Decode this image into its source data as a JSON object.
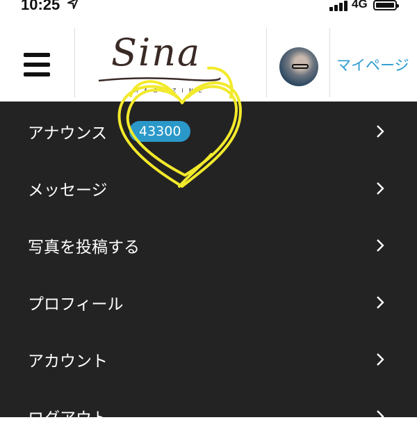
{
  "status_bar": {
    "time": "10:25",
    "network": "4G"
  },
  "header": {
    "logo_text": "Sina",
    "logo_sub": "MAGAZINE",
    "mypage_label": "マイページ"
  },
  "menu": {
    "items": [
      {
        "label": "アナウンス",
        "badge": "43300"
      },
      {
        "label": "メッセージ"
      },
      {
        "label": "写真を投稿する"
      },
      {
        "label": "プロフィール"
      },
      {
        "label": "アカウント"
      },
      {
        "label": "ログアウト"
      }
    ]
  },
  "colors": {
    "accent": "#2b9bd1",
    "menu_bg": "#232323",
    "badge_bg": "#2a98c9",
    "doodle": "#f2ea2b"
  }
}
